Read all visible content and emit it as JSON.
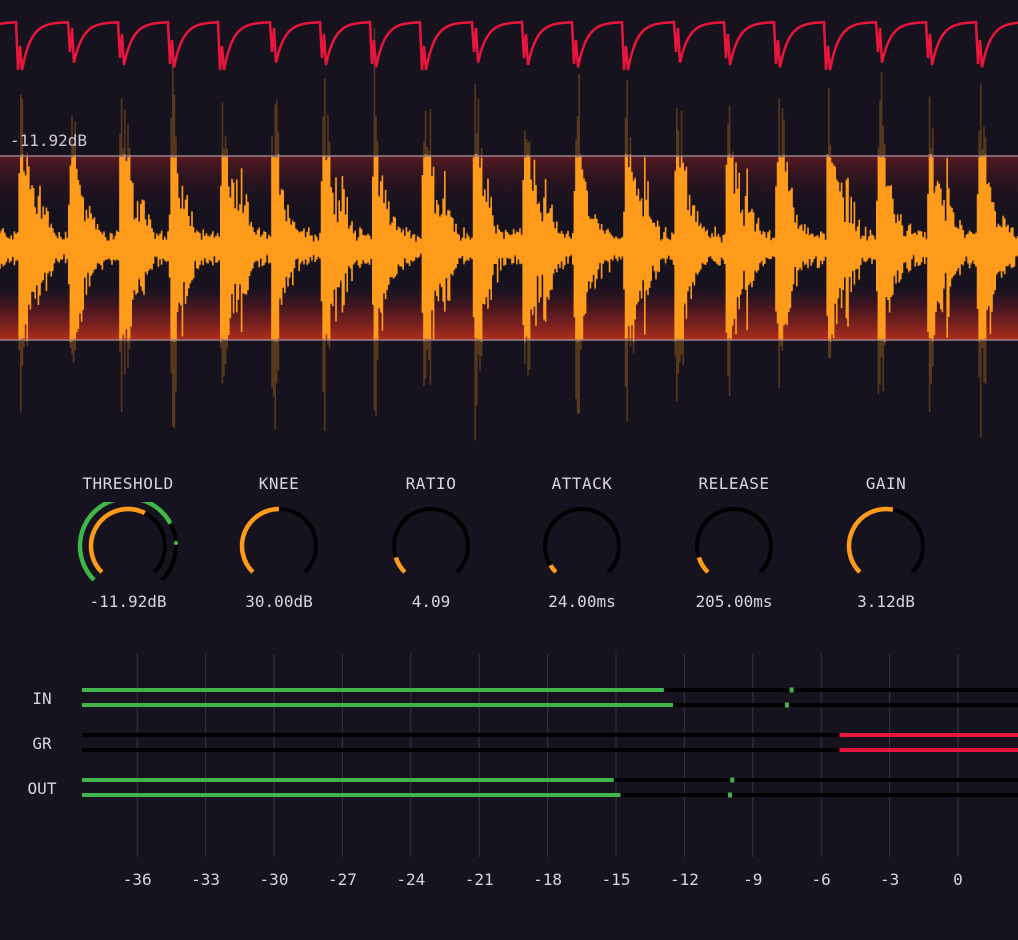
{
  "colors": {
    "background": "#16121e",
    "waveform": "#ff9b1a",
    "gain_curve": "#e8163c",
    "threshold_band": "#ff4d1a",
    "meter_green": "#3fb54a",
    "meter_red": "#e8163c",
    "knob_orange": "#ff9b1a",
    "knob_track": "#000000"
  },
  "waveform": {
    "threshold_readout": "-11.92dB"
  },
  "knobs": [
    {
      "label": "THRESHOLD",
      "value": "-11.92dB",
      "fill": 0.6,
      "icon": "threshold-knob-with-level-ring"
    },
    {
      "label": "KNEE",
      "value": "30.00dB",
      "fill": 0.5
    },
    {
      "label": "RATIO",
      "value": "4.09",
      "fill": 0.1
    },
    {
      "label": "ATTACK",
      "value": "24.00ms",
      "fill": 0.05
    },
    {
      "label": "RELEASE",
      "value": "205.00ms",
      "fill": 0.1
    },
    {
      "label": "GAIN",
      "value": "3.12dB",
      "fill": 0.54
    }
  ],
  "meters": {
    "scale_db": [
      "-36",
      "-33",
      "-30",
      "-27",
      "-24",
      "-21",
      "-18",
      "-15",
      "-12",
      "-9",
      "-6",
      "-3",
      "0"
    ],
    "rows": [
      {
        "label": "IN",
        "channels": [
          {
            "level_db": -12.9,
            "peak_db": -7.3
          },
          {
            "level_db": -12.5,
            "peak_db": -7.5
          }
        ]
      },
      {
        "label": "GR",
        "channels": [
          {
            "reduction_db": -5.2
          },
          {
            "reduction_db": -5.2
          }
        ]
      },
      {
        "label": "OUT",
        "channels": [
          {
            "level_db": -15.1,
            "peak_db": -9.9
          },
          {
            "level_db": -14.8,
            "peak_db": -10.0
          }
        ]
      }
    ]
  }
}
